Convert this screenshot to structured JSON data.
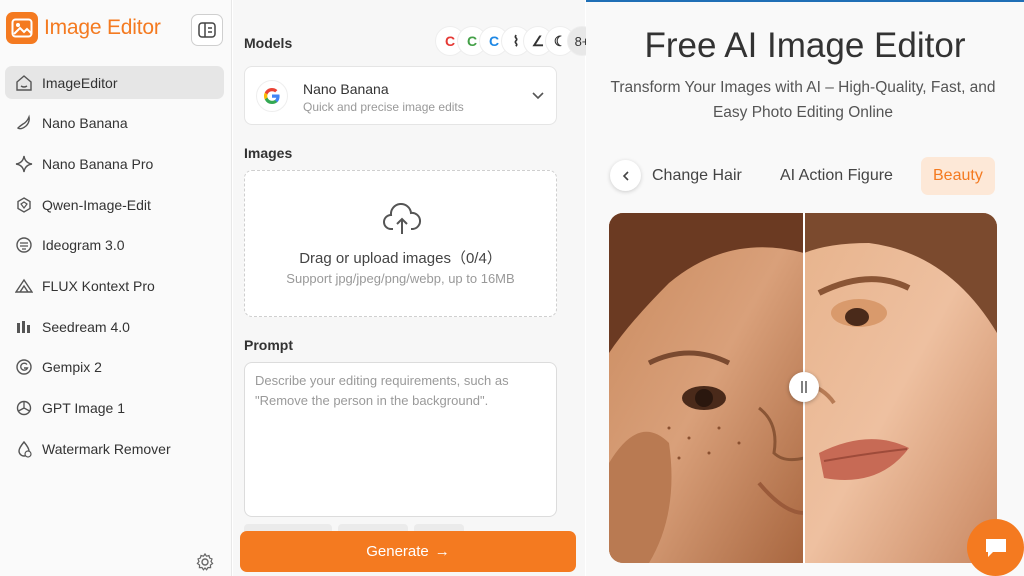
{
  "brand": {
    "title": "Image Editor"
  },
  "sidebar": {
    "items": [
      {
        "label": "ImageEditor",
        "icon": "home-icon",
        "active": true
      },
      {
        "label": "Nano Banana",
        "icon": "banana-icon"
      },
      {
        "label": "Nano Banana Pro",
        "icon": "sparkle-icon"
      },
      {
        "label": "Qwen-Image-Edit",
        "icon": "qwen-icon"
      },
      {
        "label": "Ideogram 3.0",
        "icon": "ideogram-icon"
      },
      {
        "label": "FLUX Kontext Pro",
        "icon": "flux-icon"
      },
      {
        "label": "Seedream 4.0",
        "icon": "seedream-icon"
      },
      {
        "label": "Gempix 2",
        "icon": "gempix-icon"
      },
      {
        "label": "GPT Image 1",
        "icon": "openai-icon"
      },
      {
        "label": "Watermark Remover",
        "icon": "watermark-icon"
      }
    ]
  },
  "panel": {
    "models_label": "Models",
    "model_icons_more": "8+",
    "selected_model": {
      "name": "Nano Banana",
      "description": "Quick and precise image edits"
    },
    "images_label": "Images",
    "upload": {
      "title": "Drag or upload images（0/4）",
      "subtitle": "Support jpg/jpeg/png/webp, up to 16MB"
    },
    "prompt_label": "Prompt",
    "prompt_placeholder": "Describe your editing requirements, such as \"Remove the person in the background\".",
    "prompt_value": "",
    "generate_label": "Generate"
  },
  "hero": {
    "title": "Free AI Image Editor",
    "subtitle": "Transform Your Images with AI – High-Quality, Fast, and Easy Photo Editing Online"
  },
  "tabs": [
    {
      "label": "Change Hair"
    },
    {
      "label": "AI Action Figure"
    },
    {
      "label": "Beauty",
      "active": true
    }
  ],
  "colors": {
    "accent": "#f47a20",
    "accent_soft": "#fde8d7"
  }
}
